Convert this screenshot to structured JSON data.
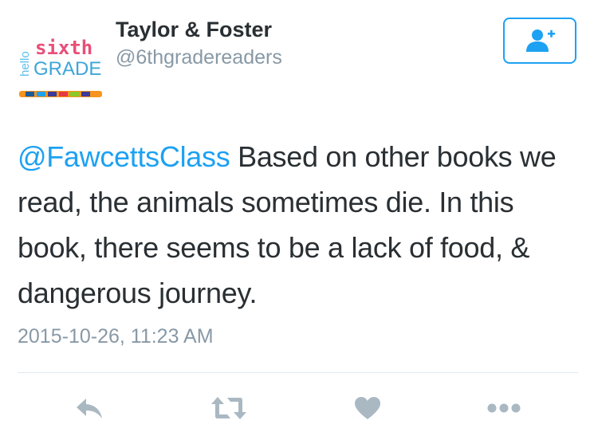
{
  "profile": {
    "avatar_icon": "hello-sixth-grade-logo",
    "logo_text_hello": "hello",
    "logo_text_sixth": "sixth",
    "logo_text_grade": "GRADE",
    "name": "Taylor & Foster",
    "handle": "@6thgradereaders"
  },
  "follow_button": {
    "icon": "add-user-icon"
  },
  "tweet": {
    "mention": "@FawcettsClass",
    "body": " Based on other books we read, the animals sometimes die. In this book, there seems to be a lack of food, & dangerous journey.",
    "timestamp": "2015-10-26, 11:23 AM"
  },
  "actions": [
    {
      "icon": "reply-icon"
    },
    {
      "icon": "retweet-icon"
    },
    {
      "icon": "like-heart-icon"
    },
    {
      "icon": "more-icon"
    }
  ],
  "colors": {
    "accent": "#1da1f2",
    "text": "#292f33",
    "muted": "#8899a6",
    "action_icons": "#aab8c2"
  }
}
